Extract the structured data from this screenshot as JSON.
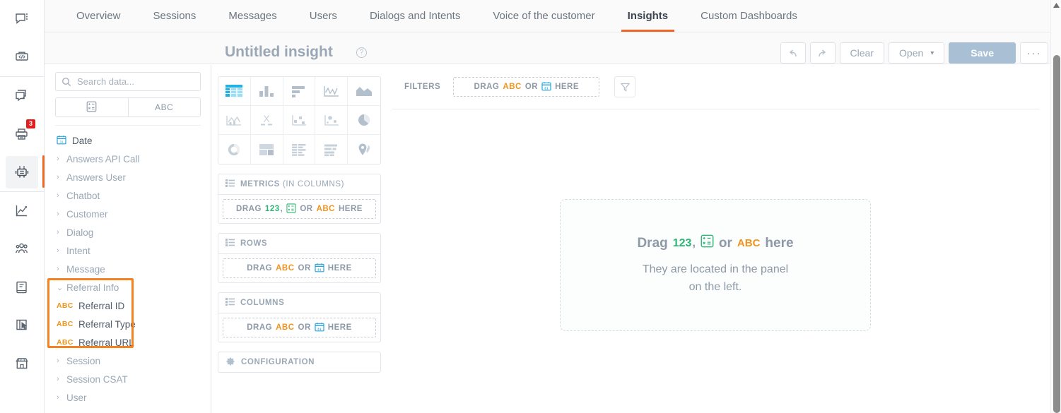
{
  "rail": {
    "items": [
      {
        "name": "chat-menu-icon",
        "icon": "chat-dots"
      },
      {
        "name": "code-widget-icon",
        "icon": "code-box"
      },
      {
        "name": "conversations-icon",
        "icon": "duplicate-chat"
      },
      {
        "name": "tickets-icon",
        "icon": "printer",
        "badge": "3"
      },
      {
        "name": "bot-icon",
        "icon": "robot",
        "active": true
      },
      {
        "name": "analytics-icon",
        "icon": "line-chart"
      },
      {
        "name": "audience-icon",
        "icon": "people"
      },
      {
        "name": "knowledge-icon",
        "icon": "book"
      },
      {
        "name": "forms-icon",
        "icon": "form-cursor"
      },
      {
        "name": "storefront-icon",
        "icon": "store"
      }
    ]
  },
  "topnav": {
    "tabs": [
      {
        "label": "Overview",
        "active": false
      },
      {
        "label": "Sessions",
        "active": false
      },
      {
        "label": "Messages",
        "active": false
      },
      {
        "label": "Users",
        "active": false
      },
      {
        "label": "Dialogs and Intents",
        "active": false
      },
      {
        "label": "Voice of the customer",
        "active": false
      },
      {
        "label": "Insights",
        "active": true
      },
      {
        "label": "Custom Dashboards",
        "active": false
      }
    ],
    "active_accent": "#f26522"
  },
  "header": {
    "title": "Untitled insight",
    "help_glyph": "?",
    "toolbar": {
      "undo_label": "↶",
      "redo_label": "↷",
      "clear_label": "Clear",
      "open_label": "Open",
      "open_caret": "▾",
      "save_label": "Save",
      "save_color": "#a9c0d4",
      "more_label": "···"
    }
  },
  "data_panel": {
    "search_placeholder": "Search data...",
    "search_value": "",
    "type_toggle": [
      {
        "label": "",
        "icon": "calculator-icon",
        "name": "measure-toggle"
      },
      {
        "label": "ABC",
        "icon": "abc-icon",
        "name": "dimension-toggle"
      }
    ],
    "date_item": {
      "label": "Date",
      "icon": "calendar-icon"
    },
    "groups": [
      {
        "label": "Answers API Call",
        "expanded": false,
        "chevron": "›"
      },
      {
        "label": "Answers User",
        "expanded": false,
        "chevron": "›"
      },
      {
        "label": "Chatbot",
        "expanded": false,
        "chevron": "›"
      },
      {
        "label": "Customer",
        "expanded": false,
        "chevron": "›"
      },
      {
        "label": "Dialog",
        "expanded": false,
        "chevron": "›"
      },
      {
        "label": "Intent",
        "expanded": false,
        "chevron": "›"
      },
      {
        "label": "Message",
        "expanded": false,
        "chevron": "›"
      },
      {
        "label": "Referral Info",
        "expanded": true,
        "chevron": "⌄",
        "fields": [
          {
            "label": "Referral ID",
            "type": "ABC"
          },
          {
            "label": "Referral Type",
            "type": "ABC"
          },
          {
            "label": "Referral URL",
            "type": "ABC"
          }
        ]
      },
      {
        "label": "Session",
        "expanded": false,
        "chevron": "›"
      },
      {
        "label": "Session CSAT",
        "expanded": false,
        "chevron": "›"
      },
      {
        "label": "User",
        "expanded": false,
        "chevron": "›"
      }
    ],
    "highlight_color": "#f58220"
  },
  "builder": {
    "chart_types": [
      {
        "name": "table-chart-icon",
        "active": true
      },
      {
        "name": "column-chart-icon",
        "active": false
      },
      {
        "name": "bar-chart-icon",
        "active": false
      },
      {
        "name": "line-chart-icon",
        "active": false
      },
      {
        "name": "area-chart-icon",
        "active": false
      },
      {
        "name": "combo-chart-icon",
        "active": false
      },
      {
        "name": "scatter-x-chart-icon",
        "active": false
      },
      {
        "name": "bubble-chart-icon",
        "active": false
      },
      {
        "name": "scatter-chart-icon",
        "active": false
      },
      {
        "name": "pie-chart-icon",
        "active": false
      },
      {
        "name": "donut-chart-icon",
        "active": false
      },
      {
        "name": "treemap-chart-icon",
        "active": false
      },
      {
        "name": "pivot-table-icon",
        "active": false
      },
      {
        "name": "list-chart-icon",
        "active": false
      },
      {
        "name": "map-chart-icon",
        "active": false
      }
    ],
    "shelves": [
      {
        "name": "metrics",
        "title": "METRICS",
        "subtitle": "(IN COLUMNS)",
        "drop": {
          "drag": "DRAG",
          "t1": "123",
          "comma": ",",
          "icon": "calculator-icon",
          "or": "OR",
          "t2": "ABC",
          "here": "HERE"
        }
      },
      {
        "name": "rows",
        "title": "ROWS",
        "subtitle": "",
        "drop": {
          "drag": "DRAG",
          "t1": "ABC",
          "or": "OR",
          "icon": "calendar-icon",
          "here": "HERE"
        }
      },
      {
        "name": "columns",
        "title": "COLUMNS",
        "subtitle": "",
        "drop": {
          "drag": "DRAG",
          "t1": "ABC",
          "or": "OR",
          "icon": "calendar-icon",
          "here": "HERE"
        }
      }
    ],
    "configuration_label": "CONFIGURATION"
  },
  "canvas": {
    "filters_label": "FILTERS",
    "filters_drop": {
      "drag": "DRAG",
      "t1": "ABC",
      "or": "OR",
      "icon": "calendar-icon",
      "here": "HERE"
    },
    "funnel_icon": "filter-funnel-icon",
    "empty_state": {
      "drag_word": "Drag",
      "token_123": "123",
      "comma": ",",
      "or_word": "or",
      "token_abc": "ABC",
      "here_word": "here",
      "sub_line1": "They are located in the panel",
      "sub_line2": "on the left."
    }
  },
  "scrollbar": {
    "up_arrow": "▲"
  }
}
